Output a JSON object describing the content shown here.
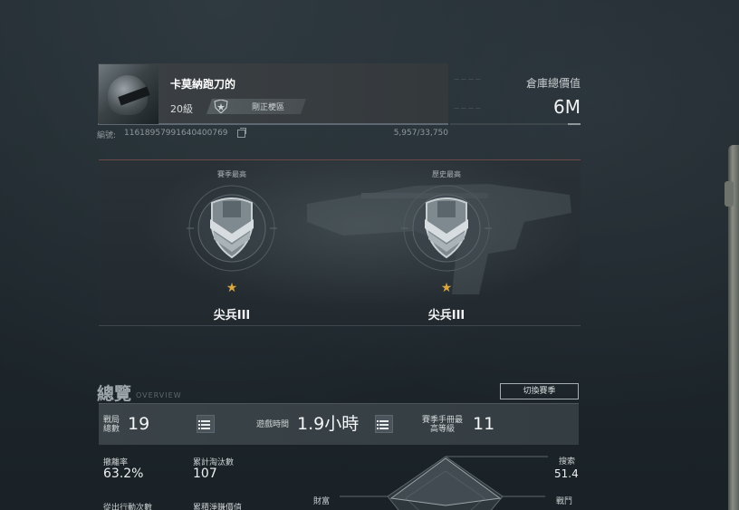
{
  "profile": {
    "name": "卡莫納跑刀的",
    "level": "20級",
    "badge_label": "剛正梗區",
    "id_label": "編號:",
    "id_value": "11618957991640400769",
    "exp": "5,957/33,750"
  },
  "wealth": {
    "label": "倉庫總價值",
    "value": "6M"
  },
  "ranks": [
    {
      "caption": "賽季最高",
      "name": "尖兵III",
      "stars": "★",
      "icon": "shield-chevron-icon"
    },
    {
      "caption": "歷史最高",
      "name": "尖兵III",
      "stars": "★",
      "icon": "shield-chevron-icon"
    }
  ],
  "overview": {
    "title": "總覽",
    "subtitle": "OVERVIEW",
    "switch_label": "切換賽季",
    "matches_label_1": "戰局",
    "matches_label_2": "總數",
    "matches_value": "19",
    "playtime_label": "遊戲時間",
    "playtime_value": "1.9小時",
    "pass_label_1": "賽季手冊最",
    "pass_label_2": "高等級",
    "pass_value": "11"
  },
  "stats": {
    "extract_rate_label": "撤離率",
    "extract_rate_value": "63.2%",
    "kills_label": "累計淘汰數",
    "kills_value": "107",
    "actions_label": "從出行動次數",
    "net_worth_label": "累積淨賺價值"
  },
  "radar": {
    "labels": {
      "search": "搜索",
      "wealth": "財富",
      "combat": "戰鬥"
    },
    "search_value": "51.4"
  },
  "colors": {
    "star": "#d9a640",
    "panel_top_line": "#6a4a44"
  }
}
